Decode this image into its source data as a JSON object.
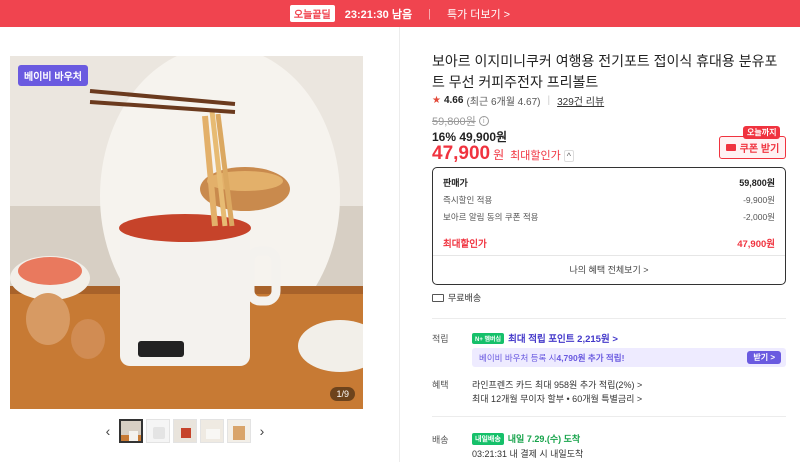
{
  "banner": {
    "deal_label": "오늘끝딜",
    "countdown": "23:21:30 남음",
    "more_link": "특가 더보기 >"
  },
  "gallery": {
    "badge": "베이비 바우처",
    "counter": "1/9",
    "prev_icon": "‹",
    "next_icon": "›"
  },
  "product": {
    "title": "보아르 이지미니쿠커 여행용 전기포트 접이식 휴대용 분유포트 무선 커피주전자 프리볼트",
    "rating": "4.66",
    "rating_detail": "(최근 6개월 4.67)",
    "review_link": "329건 리뷰",
    "original_price": "59,800원",
    "sale_line": "16% 49,900원",
    "best_price": "47,900",
    "best_won": "원",
    "best_label": "최대할인가",
    "best_toggle": "^",
    "coupon_tag": "오늘까지",
    "coupon_button": "쿠폰 받기"
  },
  "price_box": {
    "rows": [
      {
        "label": "판매가",
        "value": "59,800원"
      },
      {
        "label": "즉시할인 적용",
        "value": "-9,900원"
      },
      {
        "label": "보아르 알림 동의 쿠폰 적용",
        "value": "-2,000원"
      }
    ],
    "best_label": "최대할인가",
    "best_value": "47,900원",
    "benefits_link": "나의 혜택 전체보기 >"
  },
  "shipping": {
    "label": "무료배송"
  },
  "points": {
    "label": "적립",
    "npay": "N+ 멤버십",
    "line": "최대 적립 포인트 2,215원 >",
    "bubble_prefix": "베이비 바우처 등록 시 ",
    "bubble_strong": "4,790원 추가 적립!",
    "get_button": "받기 >"
  },
  "benefits": {
    "label": "혜택",
    "line1": "라인프렌즈 카드 최대 958원 추가 적립(2%) >",
    "line2": "최대 12개월 무이자 할부 • 60개월 특별금리 >"
  },
  "delivery": {
    "label": "배송",
    "badge": "내일배송",
    "line": "내일 7.29.(수) 도착",
    "sub": "03:21:31  내 결제 시 내일도착"
  }
}
